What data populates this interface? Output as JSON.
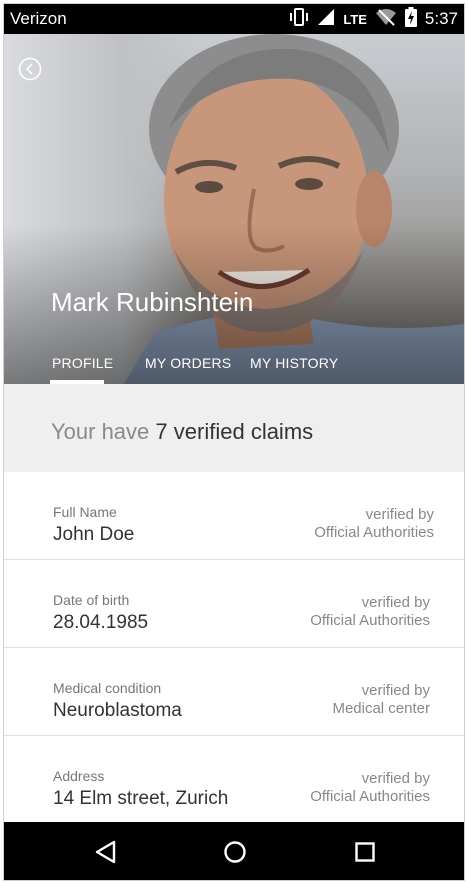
{
  "status_bar": {
    "carrier": "Verizon",
    "network": "LTE",
    "time": "5:37",
    "icons": [
      "vibrate-icon",
      "signal-icon",
      "wifi-off-icon",
      "battery-charging-icon"
    ]
  },
  "header": {
    "back_icon": "back-circle-icon",
    "name": "Mark Rubinshtein",
    "tabs": [
      {
        "label": "PROFILE",
        "active": true
      },
      {
        "label": "MY ORDERS",
        "active": false
      },
      {
        "label": "MY HISTORY",
        "active": false
      }
    ]
  },
  "summary": {
    "prefix": "Your have",
    "count": "7",
    "suffix": "verified claims"
  },
  "claims": [
    {
      "label": "Full Name",
      "value": "John Doe",
      "verified_by": "verified by",
      "authority": "Official Authorities"
    },
    {
      "label": "Date of birth",
      "value": "28.04.1985",
      "verified_by": "verified by",
      "authority": "Official Authorities"
    },
    {
      "label": "Medical condition",
      "value": "Neuroblastoma",
      "verified_by": "verified by",
      "authority": "Medical center"
    },
    {
      "label": "Address",
      "value": "14 Elm street, Zurich",
      "verified_by": "verified by",
      "authority": "Official Authorities"
    }
  ],
  "nav_bar": {
    "buttons": [
      "back-triangle-icon",
      "home-circle-icon",
      "recents-square-icon"
    ]
  },
  "colors": {
    "accent": "#ffffff",
    "summary_bg": "#efefef",
    "status_bar": "#000000",
    "nav_bar": "#000000"
  }
}
